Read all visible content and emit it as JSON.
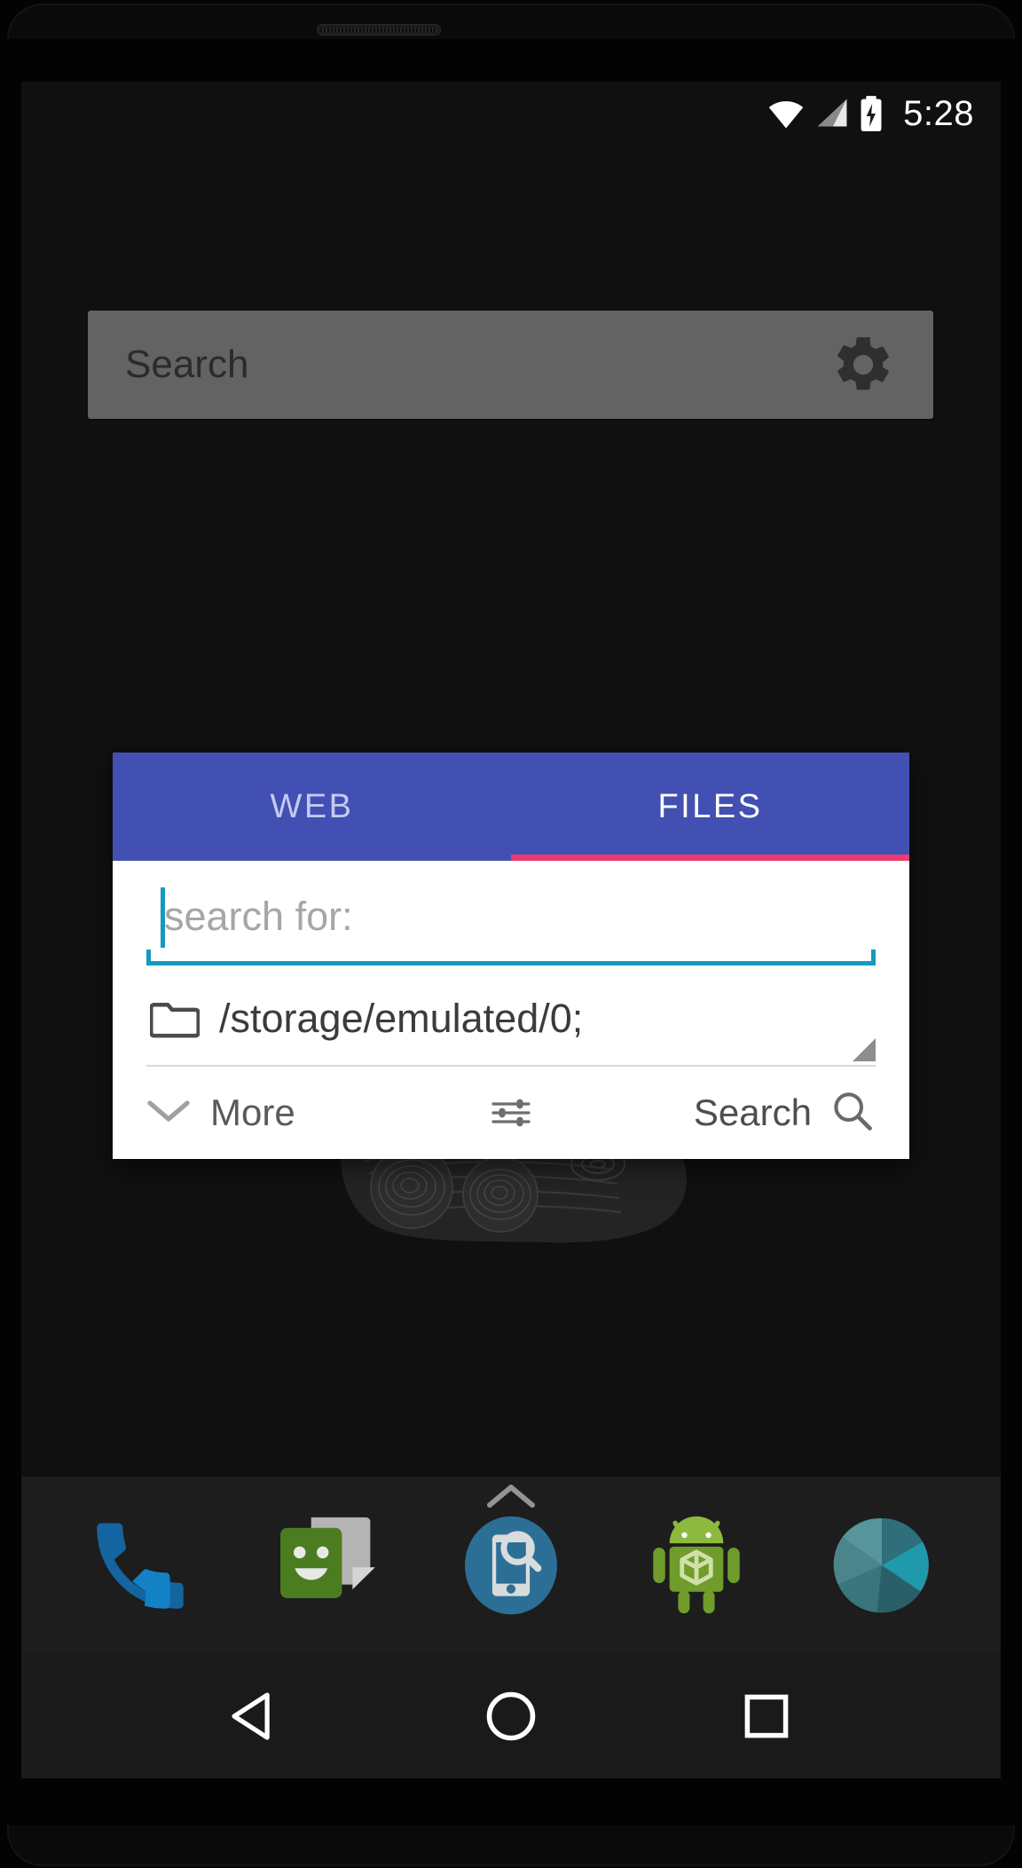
{
  "status_bar": {
    "time": "5:28",
    "icons": [
      "wifi-icon",
      "cellular-signal-icon",
      "battery-charging-icon"
    ]
  },
  "home_screen": {
    "search_widget": {
      "placeholder": "Search",
      "settings_icon": "gear-icon"
    },
    "apps_chevron_icon": "chevron-up-icon",
    "dock": {
      "items": [
        {
          "name": "phone",
          "label": "Phone"
        },
        {
          "name": "messaging",
          "label": "Messaging"
        },
        {
          "name": "device-search",
          "label": "Search"
        },
        {
          "name": "android-apps",
          "label": "Apps"
        },
        {
          "name": "camera",
          "label": "Camera"
        }
      ]
    },
    "nav_bar": {
      "back": "Back",
      "home": "Home",
      "recents": "Recents"
    }
  },
  "dialog": {
    "tabs": [
      {
        "label": "WEB",
        "active": false
      },
      {
        "label": "FILES",
        "active": true
      }
    ],
    "indicator_color": "#ed3b6e",
    "header_color": "#4250b4",
    "search_field": {
      "value": "",
      "placeholder": "search for:",
      "accent_color": "#1699bf",
      "caret_visible": true
    },
    "path_row": {
      "icon": "folder-icon",
      "value": "/storage/emulated/0;",
      "resize_handle": true
    },
    "actions": {
      "more_label": "More",
      "more_icon": "chevron-down-icon",
      "tune_icon": "tune-sliders-icon",
      "search_label": "Search",
      "search_icon": "magnifier-icon"
    }
  }
}
